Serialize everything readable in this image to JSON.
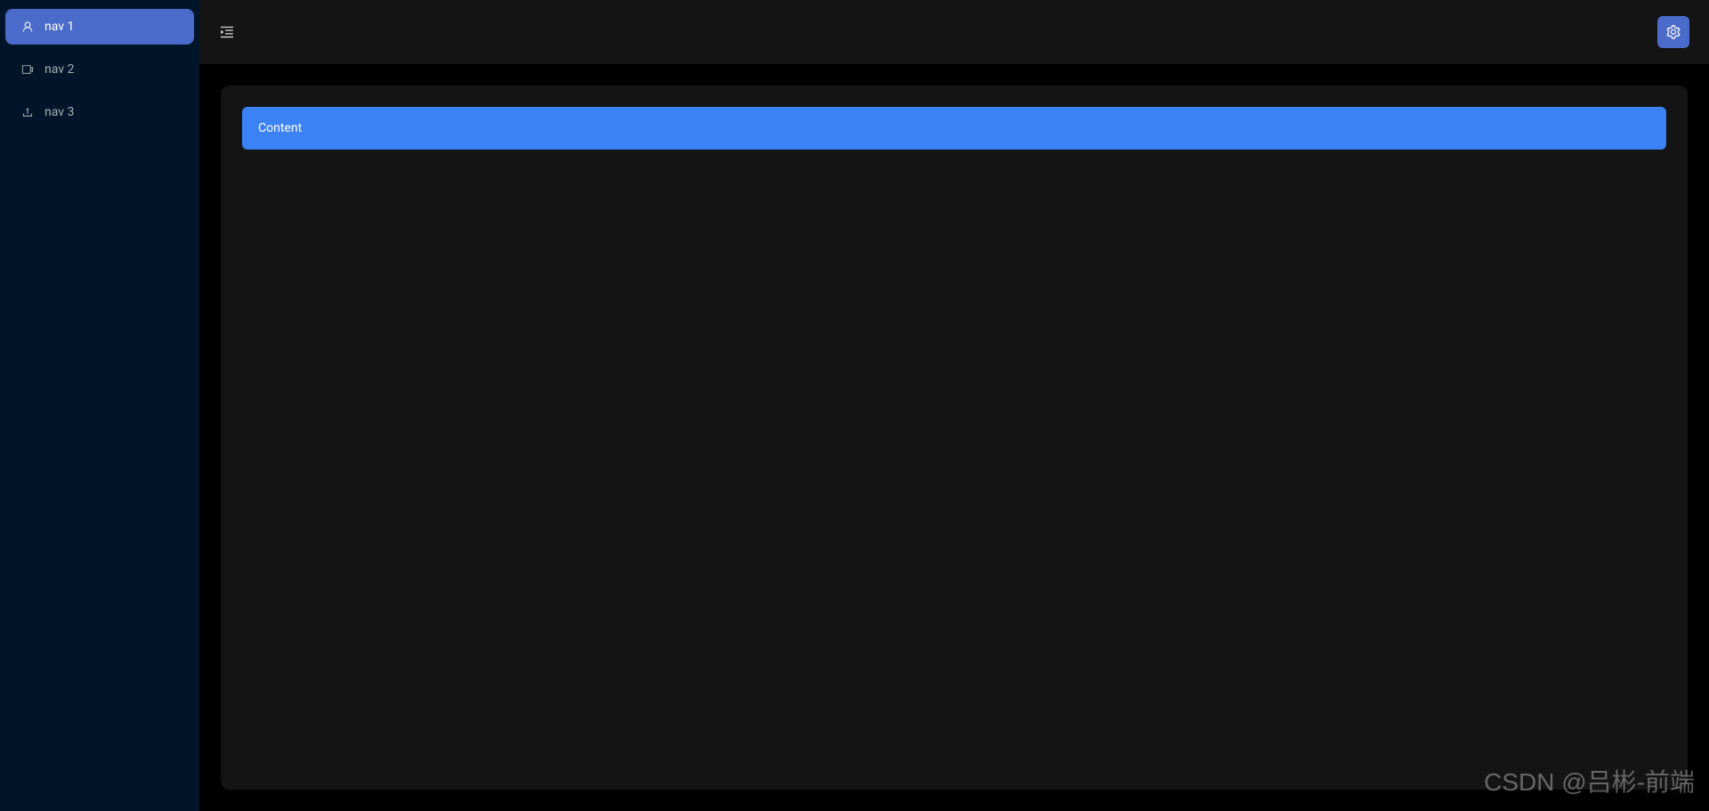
{
  "sidebar": {
    "items": [
      {
        "label": "nav 1",
        "icon": "user-icon",
        "active": true
      },
      {
        "label": "nav 2",
        "icon": "video-icon",
        "active": false
      },
      {
        "label": "nav 3",
        "icon": "upload-icon",
        "active": false
      }
    ]
  },
  "header": {
    "menu_toggle": "menu-fold",
    "settings": "settings"
  },
  "content": {
    "text": "Content"
  },
  "watermark": "CSDN @吕彬-前端",
  "colors": {
    "sidebar_bg": "#001529",
    "panel_bg": "#141414",
    "accent": "#4a6bc9",
    "content_bar": "#3b82f6"
  }
}
